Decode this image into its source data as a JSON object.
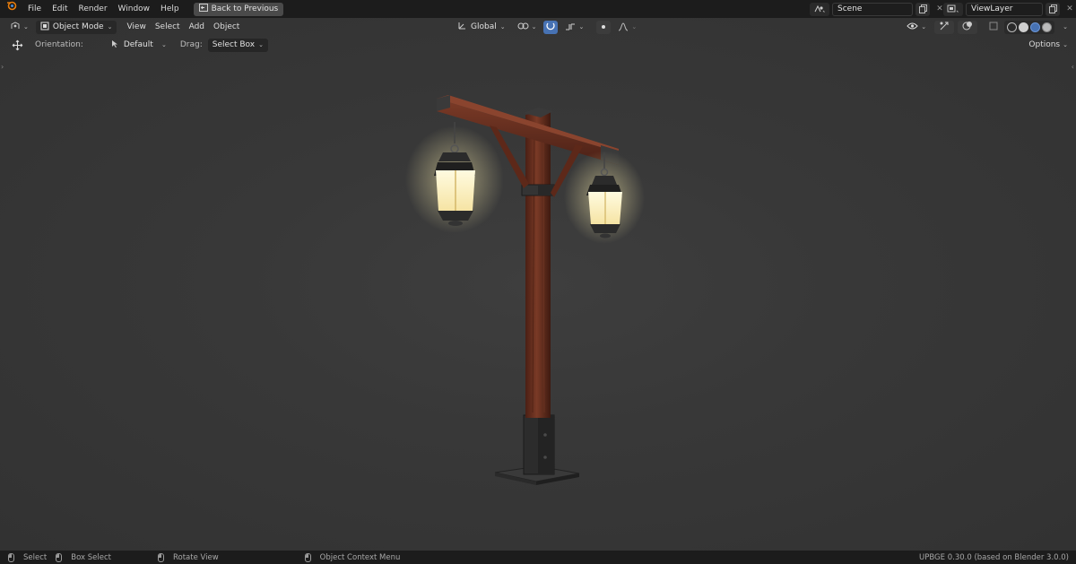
{
  "app": {
    "menus": [
      "File",
      "Edit",
      "Render",
      "Window",
      "Help"
    ],
    "back_button": "Back to Previous",
    "scene": "Scene",
    "view_layer": "ViewLayer"
  },
  "viewport_header": {
    "mode": "Object Mode",
    "menus": [
      "View",
      "Select",
      "Add",
      "Object"
    ],
    "transform_orientation": "Global"
  },
  "tool_header": {
    "orientation_label": "Orientation:",
    "orientation_value": "Default",
    "drag_label": "Drag:",
    "drag_value": "Select Box",
    "options_label": "Options"
  },
  "status_bar": {
    "select": "Select",
    "box_select": "Box Select",
    "rotate_view": "Rotate View",
    "context_menu": "Object Context Menu",
    "version": "UPBGE 0.30.0 (based on Blender 3.0.0)"
  },
  "colors": {
    "topbar_bg": "#1c1c1c",
    "viewport_bg": "#3a3a3a",
    "accent_blue": "#4772b3",
    "wood": "#6b2f1f",
    "lantern_glow": "#fff3c4"
  },
  "icons": [
    "blender-logo-icon",
    "back-icon",
    "scene-icon",
    "viewlayer-icon",
    "editor-type-icon",
    "object-mode-icon",
    "orientation-icon",
    "pivot-icon",
    "snap-icon",
    "proportional-icon",
    "visibility-icon",
    "gizmo-icon",
    "overlay-icon",
    "xray-icon",
    "wireframe-icon",
    "solid-icon",
    "material-icon",
    "rendered-icon",
    "mouse-icon",
    "move-icon",
    "cursor-icon"
  ]
}
